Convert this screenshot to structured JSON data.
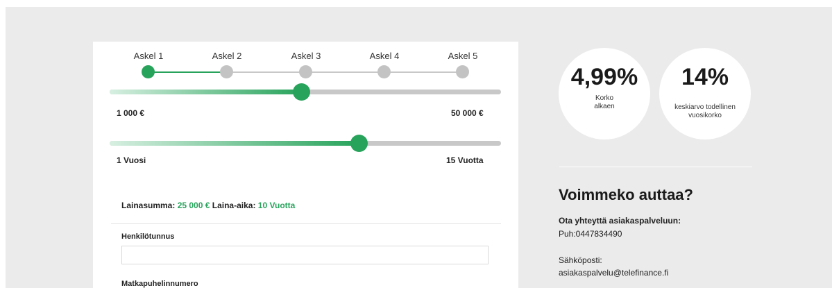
{
  "stepper": {
    "steps": [
      {
        "label": "Askel 1",
        "active": true
      },
      {
        "label": "Askel 2",
        "active": false
      },
      {
        "label": "Askel 3",
        "active": false
      },
      {
        "label": "Askel 4",
        "active": false
      },
      {
        "label": "Askel 5",
        "active": false
      }
    ]
  },
  "amount_slider": {
    "min_label": "1 000 €",
    "max_label": "50 000 €",
    "fill_fraction": 0.49
  },
  "term_slider": {
    "min_label": "1 Vuosi",
    "max_label": "15 Vuotta",
    "fill_fraction": 0.64
  },
  "summary": {
    "amount_label": "Lainasumma: ",
    "amount_value": "25 000 €",
    "term_label": " Laina-aika: ",
    "term_value": "10 Vuotta"
  },
  "form": {
    "ssn_label": "Henkilötunnus",
    "ssn_value": "",
    "phone_label": "Matkapuhelinnumero"
  },
  "rates": {
    "interest_value": "4,99%",
    "interest_caption_line1": "Korko",
    "interest_caption_line2": "alkaen",
    "apr_value": "14%",
    "apr_caption_line1": "keskiarvo todellinen",
    "apr_caption_line2": "vuosikorko"
  },
  "help": {
    "title": "Voimmeko auttaa?",
    "contact_heading": "Ota yhteyttä asiakaspalveluun:",
    "phone": "Puh:0447834490",
    "email_label": "Sähköposti:",
    "email": "asiakaspalvelu@telefinance.fi"
  },
  "colors": {
    "accent": "#27a35b",
    "inactive": "#c3c3c3",
    "background": "#ebebeb"
  }
}
